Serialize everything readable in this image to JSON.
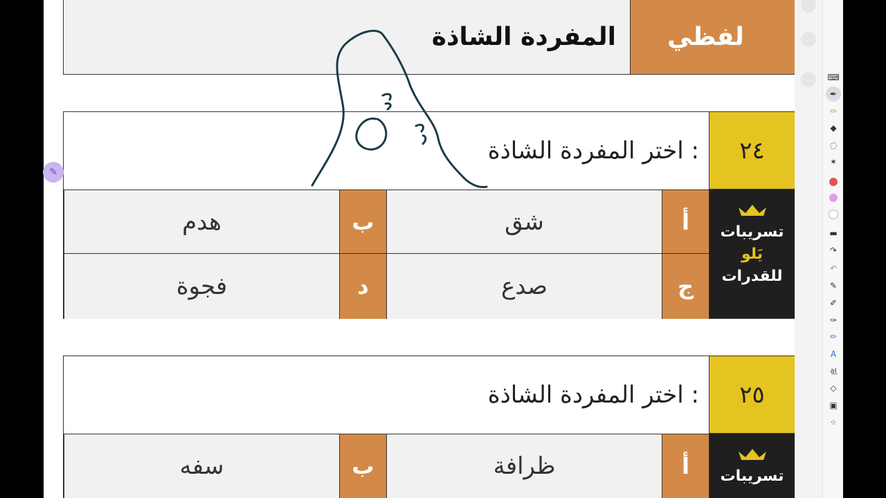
{
  "header": {
    "category": "لفظي",
    "title": "المفردة الشاذة"
  },
  "questions": [
    {
      "number": "٢٤",
      "prompt": "اختر المفردة الشاذة :",
      "brand": {
        "line1": "تسريبات",
        "line2": "يَلو",
        "line3": "للقدرات"
      },
      "options": [
        {
          "letter": "أ",
          "text": "شق"
        },
        {
          "letter": "ب",
          "text": "هدم"
        },
        {
          "letter": "ج",
          "text": "صدع"
        },
        {
          "letter": "د",
          "text": "فجوة"
        }
      ]
    },
    {
      "number": "٢٥",
      "prompt": "اختر المفردة الشاذة :",
      "brand": {
        "line1": "تسريبات"
      },
      "options": [
        {
          "letter": "أ",
          "text": "ظرافة"
        },
        {
          "letter": "ب",
          "text": "سفه"
        }
      ]
    }
  ],
  "toolbar": {
    "tools": [
      "keyboard-icon",
      "pen-icon",
      "highlighter-icon",
      "eraser-icon",
      "lasso-icon",
      "magic-icon",
      "color-red",
      "color-pink",
      "color-white",
      "stroke-width-icon",
      "redo-icon",
      "undo-icon",
      "shape-pen-icon",
      "shape-fill-icon",
      "ruler-pen-icon",
      "purple-pen-icon",
      "text-icon",
      "text-format-icon",
      "shapes-icon",
      "insert-icon",
      "more-icon"
    ],
    "colors": {
      "red": "#e05555",
      "pink": "#e39be8",
      "white": "#ffffff"
    }
  },
  "colors": {
    "accent_orange": "#d38a48",
    "accent_yellow": "#e5c321",
    "brand_dark": "#1f1f1f"
  }
}
